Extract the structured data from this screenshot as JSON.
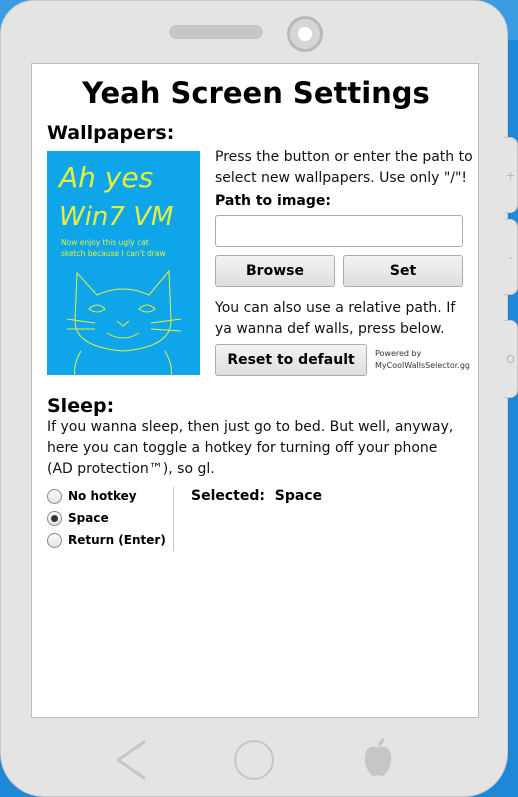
{
  "title": "Yeah Screen Settings",
  "wallpapers": {
    "heading": "Wallpapers:",
    "thumbnail_line1": "Ah yes",
    "thumbnail_line2": "Win7 VM",
    "thumbnail_caption1": "Now enjoy this ugly cat",
    "thumbnail_caption2": "sketch because I can't draw",
    "description": "Press the button or enter the path to select new wallpapers. Use only \"/\"!",
    "path_label": "Path to image:",
    "path_value": "",
    "browse_label": "Browse",
    "set_label": "Set",
    "relative_note": "You can also use a relative path. If ya wanna def walls, press below.",
    "reset_label": "Reset to default",
    "powered_line1": "Powered by",
    "powered_line2": "MyCoolWallsSelector.gg"
  },
  "sleep": {
    "heading": "Sleep:",
    "description": "If you wanna sleep, then just go to bed. But well, anyway, here you can toggle a hotkey for turning off your phone (AD protection™), so gl.",
    "options": [
      "No hotkey",
      "Space",
      "Return (Enter)"
    ],
    "selected_index": 1,
    "selected_label": "Selected:",
    "selected_value": "Space"
  },
  "side_buttons": [
    "+",
    "-",
    "O"
  ],
  "colors": {
    "wallpaper_bg": "#0ea5ea",
    "wallpaper_text": "#e6f03c",
    "phone_body": "#e4e4e4",
    "desktop_bg": "#1e88d8"
  }
}
